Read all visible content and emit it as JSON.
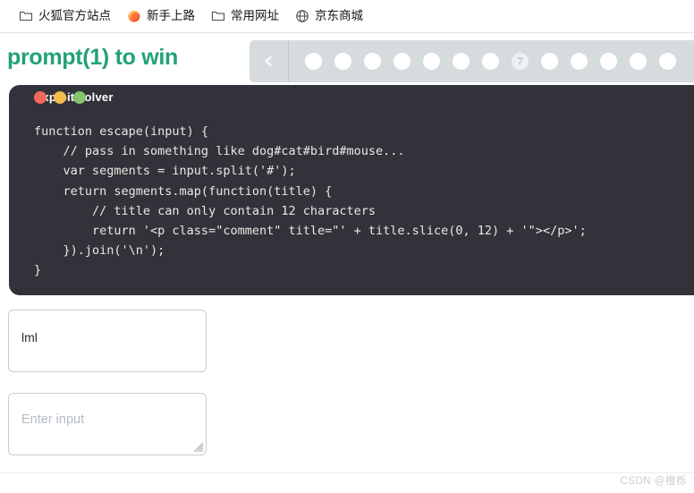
{
  "bookmarks": {
    "items": [
      {
        "icon": "folder-icon",
        "label": "火狐官方站点"
      },
      {
        "icon": "firefox-icon",
        "label": "新手上路"
      },
      {
        "icon": "folder-icon",
        "label": "常用网址"
      },
      {
        "icon": "globe-icon",
        "label": "京东商城"
      }
    ]
  },
  "header": {
    "title": "prompt(1) to win",
    "title_color": "#21a179"
  },
  "pager": {
    "back_icon": "chevron-left-icon",
    "background": "#d6dbdd",
    "current_label": "7",
    "current_index": 7,
    "total_dots": 13
  },
  "code_panel": {
    "background": "#32323a",
    "window_title": "exploit/solver",
    "lights": [
      {
        "name": "close-light",
        "color": "#f4685f"
      },
      {
        "name": "minimize-light",
        "color": "#f5bb4f"
      },
      {
        "name": "maximize-light",
        "color": "#87c56c"
      }
    ],
    "lines": [
      "function escape(input) {",
      "    // pass in something like dog#cat#bird#mouse...",
      "    var segments = input.split('#');",
      "    return segments.map(function(title) {",
      "        // title can only contain 12 characters",
      "        return '<p class=\"comment\" title=\"' + title.slice(0, 12) + '\"></p>';",
      "    }).join('\\n');",
      "}"
    ]
  },
  "output": {
    "value": "lml"
  },
  "input": {
    "value": "",
    "placeholder": "Enter input"
  },
  "watermark": {
    "text": "CSDN @橙栎"
  }
}
